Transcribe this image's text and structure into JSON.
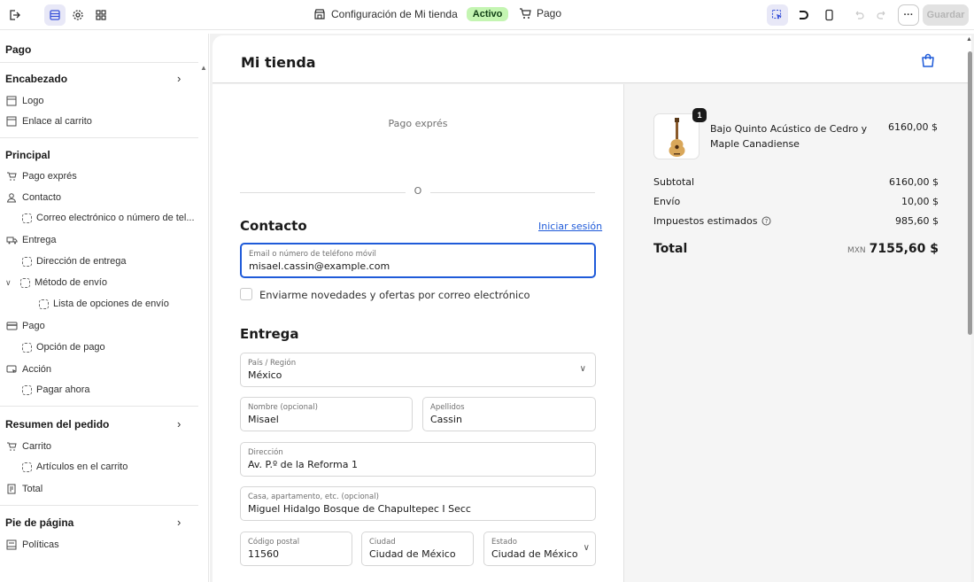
{
  "topbar": {
    "store_title": "Configuración de Mi tienda",
    "status_badge": "Activo",
    "template_select": "Pago",
    "save_label": "Guardar",
    "more_label": "···"
  },
  "sidebar": {
    "section_title": "Pago",
    "groups": [
      {
        "title": "Encabezado",
        "items": [
          "Logo",
          "Enlace al carrito"
        ]
      },
      {
        "title": "Principal",
        "items": [
          "Pago exprés",
          "Contacto",
          "Correo electrónico o número de tel...",
          "Entrega",
          "Dirección de entrega",
          "Método de envío",
          "Lista de opciones de envío",
          "Pago",
          "Opción de pago",
          "Acción",
          "Pagar ahora"
        ]
      },
      {
        "title": "Resumen del pedido",
        "items": [
          "Carrito",
          "Artículos en el carrito",
          "Total"
        ]
      },
      {
        "title": "Pie de página",
        "items": [
          "Políticas"
        ]
      }
    ]
  },
  "preview": {
    "store_name": "Mi tienda",
    "express_label": "Pago exprés",
    "or_label": "O",
    "contact": {
      "heading": "Contacto",
      "login_link": "Iniciar sesión",
      "email_label": "Email o número de teléfono móvil",
      "email_value": "misael.cassin@example.com",
      "newsletter_label": "Enviarme novedades y ofertas por correo electrónico"
    },
    "delivery": {
      "heading": "Entrega",
      "country_label": "País / Región",
      "country_value": "México",
      "first_name_label": "Nombre (opcional)",
      "first_name_value": "Misael",
      "last_name_label": "Apellidos",
      "last_name_value": "Cassin",
      "address_label": "Dirección",
      "address_value": "Av. P.º de la Reforma 1",
      "apt_label": "Casa, apartamento, etc. (opcional)",
      "apt_value": "Miguel Hidalgo Bosque de Chapultepec I Secc",
      "postal_label": "Código postal",
      "postal_value": "11560",
      "city_label": "Ciudad",
      "city_value": "Ciudad de México",
      "state_label": "Estado",
      "state_value": "Ciudad de México"
    },
    "summary": {
      "product_name": "Bajo Quinto Acústico de Cedro y Maple Canadiense",
      "product_price": "6160,00 $",
      "quantity": "1",
      "subtotal_label": "Subtotal",
      "subtotal_value": "6160,00 $",
      "shipping_label": "Envío",
      "shipping_value": "10,00 $",
      "taxes_label": "Impuestos estimados",
      "taxes_value": "985,60 $",
      "total_label": "Total",
      "currency": "MXN",
      "total_value": "7155,60 $"
    }
  },
  "colors": {
    "accent": "#1f5bd9",
    "badge_bg": "#c4f5b2",
    "selected_tool": "#e8e8f7"
  }
}
